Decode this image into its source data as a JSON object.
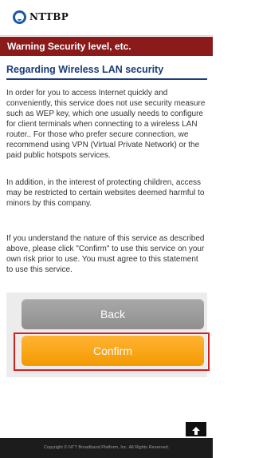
{
  "header": {
    "logo_text": "NTTBP",
    "logo_icon": "ntt-logo-icon"
  },
  "warning_bar": {
    "label": "Warning Security level, etc."
  },
  "section": {
    "title": "Regarding Wireless LAN security"
  },
  "content": {
    "paragraph_1": "In order for you to access Internet quickly and conveniently, this service does not use security measure such as WEP key, which one usually needs to configure for client terminals when connecting to a wireless LAN router.. For those who prefer secure connection, we recommend using VPN (Virtual Private Network) or the paid public hotspots services.",
    "paragraph_2": "In addition, in the interest of protecting children, access may be restricted to certain websites deemed harmful to minors by this company.",
    "paragraph_3": "If you understand the nature of this service as described above, please click \"Confirm\" to use this service on your own risk prior to use. You must agree to this statement to use this service."
  },
  "buttons": {
    "back_label": "Back",
    "confirm_label": "Confirm"
  },
  "scroll_top": {
    "icon": "arrow-up-icon"
  },
  "footer": {
    "copyright": "Copyright © NTT Broadband Platform, Inc. All Rights Reserved."
  },
  "colors": {
    "warning_bar": "#8b1a1a",
    "section_title": "#1a3c78",
    "confirm_button": "#f7a21a",
    "back_button": "#9b9b9b",
    "highlight": "#d11f1f",
    "footer": "#1c1c1c"
  }
}
